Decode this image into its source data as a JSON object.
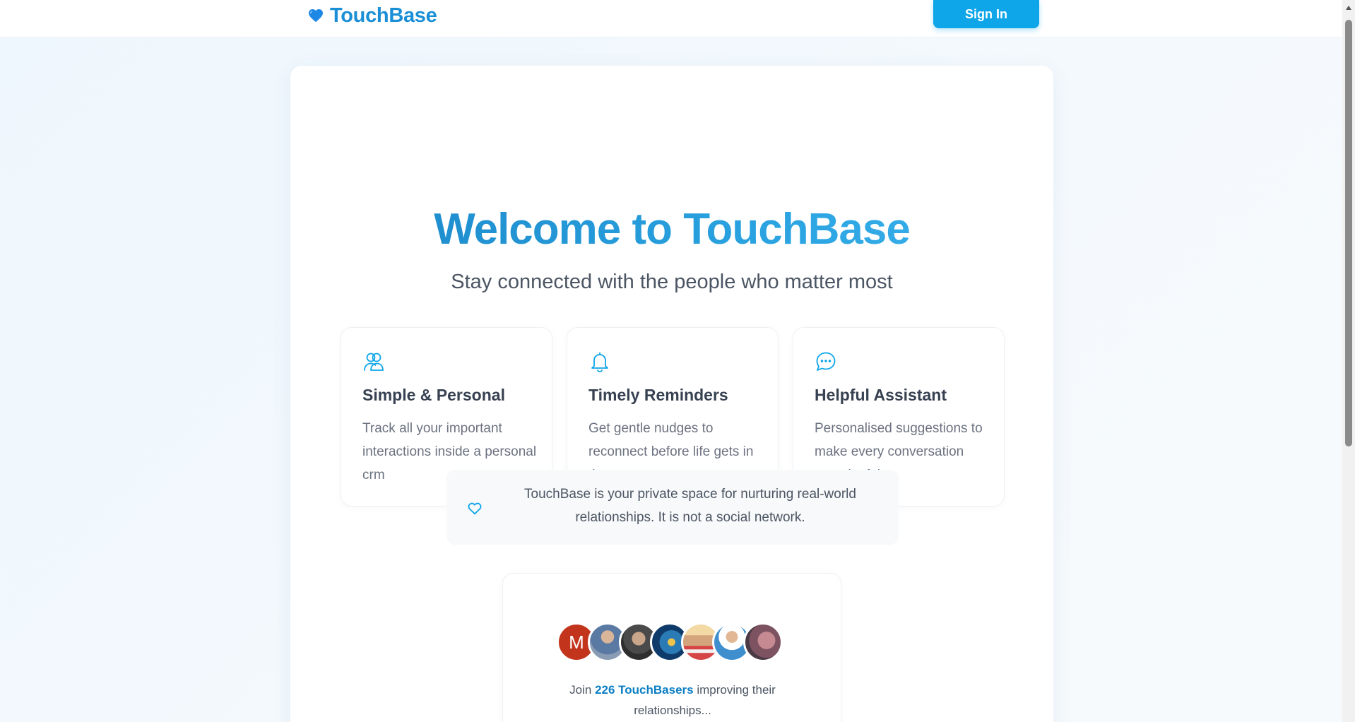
{
  "header": {
    "logo_text": "TouchBase",
    "sign_in_label": "Sign In"
  },
  "hero": {
    "title": "Welcome to TouchBase",
    "subtitle": "Stay connected with the people who matter most"
  },
  "features": [
    {
      "icon": "users-icon",
      "title": "Simple & Personal",
      "description": "Track all your important interactions inside a personal crm"
    },
    {
      "icon": "bell-icon",
      "title": "Timely Reminders",
      "description": "Get gentle nudges to reconnect before life gets in the way"
    },
    {
      "icon": "chat-bubble-icon",
      "title": "Helpful Assistant",
      "description": "Personalised suggestions to make every conversation meaningful"
    }
  ],
  "notice": {
    "icon": "heart-outline-icon",
    "text": "TouchBase is your private space for nurturing real-world relationships. It is not a social network."
  },
  "social_proof": {
    "avatar_letter": "M",
    "prefix": "Join",
    "highlight": "226 TouchBasers",
    "suffix": "improving their relationships..."
  },
  "colors": {
    "accent": "#0ea5e9",
    "brand": "#1a8fd6",
    "avatar_m": "#c2341c"
  }
}
